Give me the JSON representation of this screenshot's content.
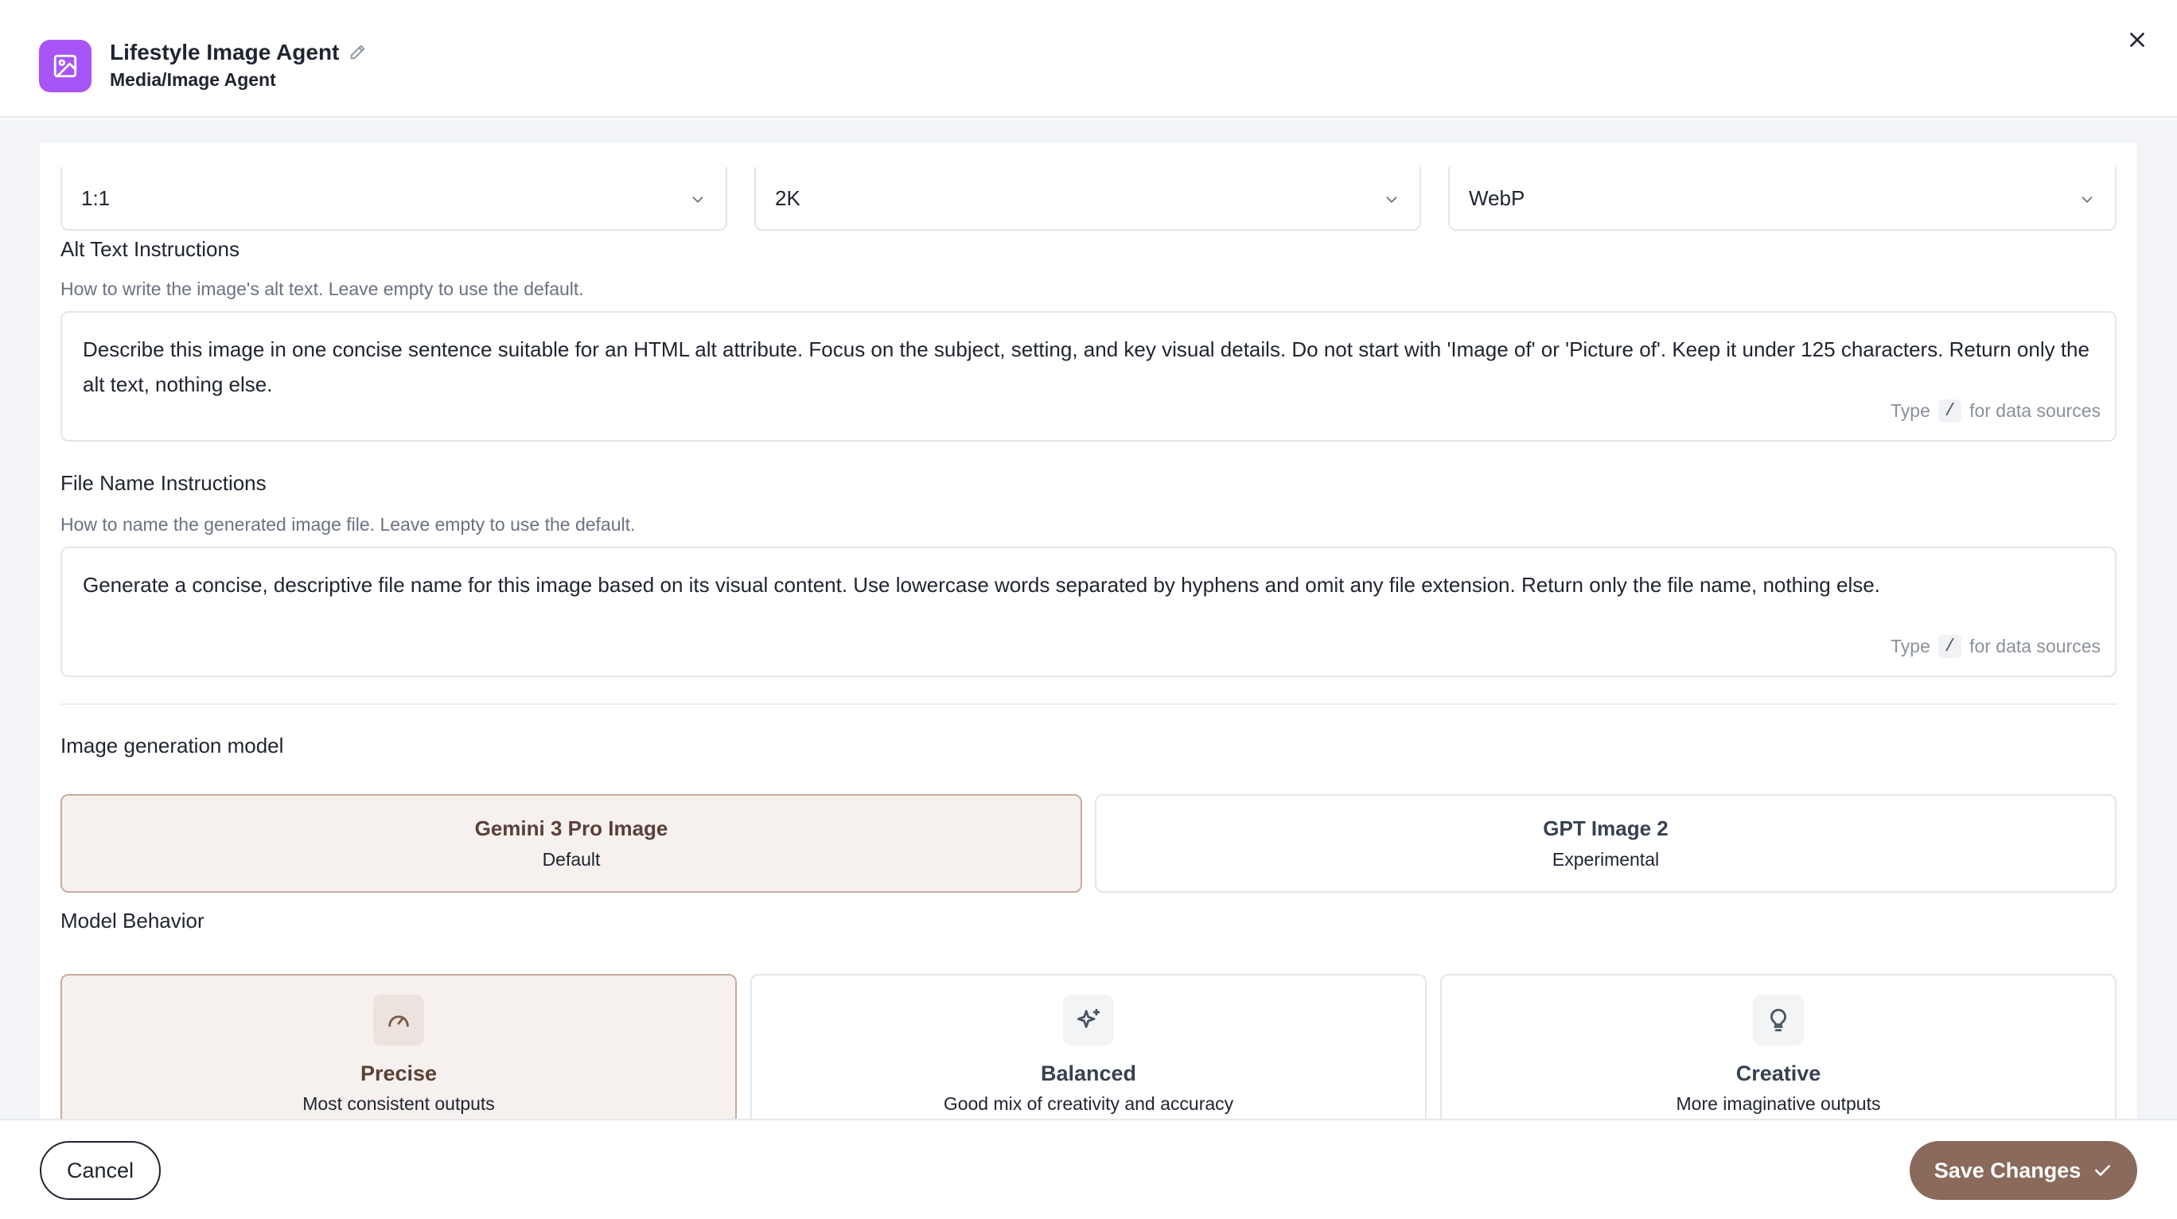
{
  "header": {
    "title": "Lifestyle Image Agent",
    "subtitle": "Media/Image Agent",
    "app_icon": "image-icon",
    "accent_color": "#a855f7"
  },
  "selects": {
    "aspect_ratio": "1:1",
    "resolution": "2K",
    "format": "WebP"
  },
  "alt_text": {
    "label": "Alt Text Instructions",
    "hint": "How to write the image's alt text. Leave empty to use the default.",
    "value": "Describe this image in one concise sentence suitable for an HTML alt attribute. Focus on the subject, setting, and key visual details. Do not start with 'Image of' or 'Picture of'. Keep it under 125 characters. Return only the alt text, nothing else.",
    "ds_type": "Type",
    "ds_slash": "/",
    "ds_suffix": "for data sources"
  },
  "file_name": {
    "label": "File Name Instructions",
    "hint": "How to name the generated image file. Leave empty to use the default.",
    "value": "Generate a concise, descriptive file name for this image based on its visual content. Use lowercase words separated by hyphens and omit any file extension. Return only the file name, nothing else.",
    "ds_type": "Type",
    "ds_slash": "/",
    "ds_suffix": "for data sources"
  },
  "model": {
    "label": "Image generation model",
    "options": [
      {
        "name": "Gemini 3 Pro Image",
        "sub": "Default",
        "selected": true
      },
      {
        "name": "GPT Image 2",
        "sub": "Experimental",
        "selected": false
      }
    ]
  },
  "behavior": {
    "label": "Model Behavior",
    "options": [
      {
        "name": "Precise",
        "sub": "Most consistent outputs",
        "icon": "gauge-icon",
        "selected": true
      },
      {
        "name": "Balanced",
        "sub": "Good mix of creativity and accuracy",
        "icon": "sparkles-icon",
        "selected": false
      },
      {
        "name": "Creative",
        "sub": "More imaginative outputs",
        "icon": "lightbulb-icon",
        "selected": false
      }
    ]
  },
  "footer": {
    "cancel_label": "Cancel",
    "save_label": "Save Changes",
    "save_color": "#8a6a5b"
  }
}
